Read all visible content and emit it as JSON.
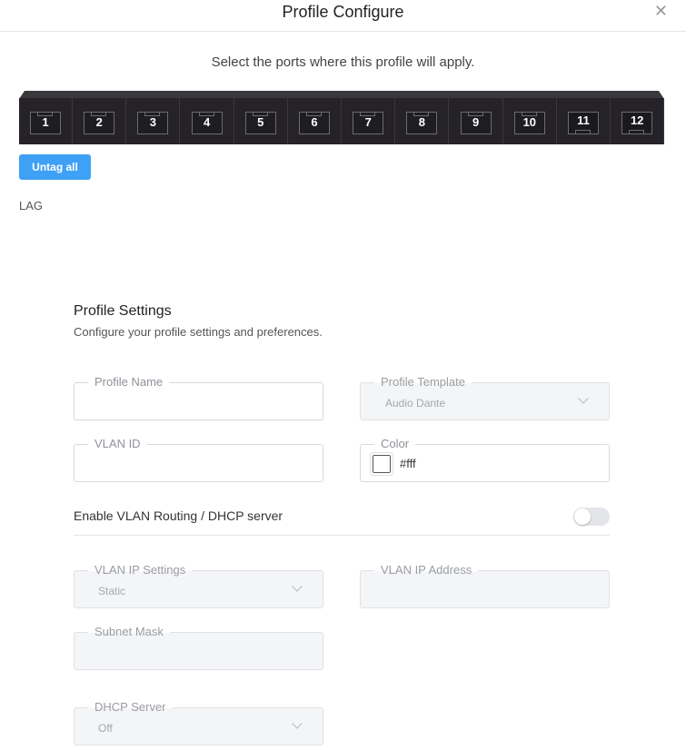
{
  "dialog": {
    "title": "Profile Configure",
    "close_icon": "close-icon",
    "close_glyph": "✕"
  },
  "ports_section": {
    "instruction": "Select the ports where this profile will apply.",
    "ports": [
      "1",
      "2",
      "3",
      "4",
      "5",
      "6",
      "7",
      "8",
      "9",
      "10",
      "11",
      "12"
    ],
    "untag_all_label": "Untag all",
    "lag_label": "LAG"
  },
  "profile_settings": {
    "title": "Profile Settings",
    "subtitle": "Configure your profile settings and preferences.",
    "profile_name": {
      "label": "Profile Name",
      "value": ""
    },
    "profile_template": {
      "label": "Profile Template",
      "value": "Audio Dante"
    },
    "vlan_id": {
      "label": "VLAN ID",
      "value": ""
    },
    "color": {
      "label": "Color",
      "value": "#fff"
    },
    "routing_toggle": {
      "label": "Enable VLAN Routing / DHCP server",
      "enabled": false
    },
    "vlan_ip_settings": {
      "label": "VLAN IP Settings",
      "value": "Static"
    },
    "vlan_ip_address": {
      "label": "VLAN IP Address",
      "value": ""
    },
    "subnet_mask": {
      "label": "Subnet Mask",
      "value": ""
    },
    "dhcp_server": {
      "label": "DHCP Server",
      "value": "Off"
    }
  },
  "colors": {
    "accent": "#3ea1f5",
    "switch_body": "#252327"
  }
}
